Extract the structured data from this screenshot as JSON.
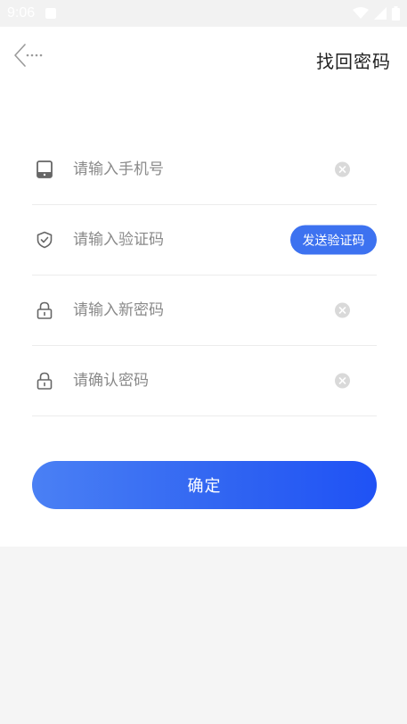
{
  "status_bar": {
    "time": "9:06"
  },
  "header": {
    "title": "找回密码",
    "back_icon": "back-arrow-icon"
  },
  "form": {
    "phone": {
      "placeholder": "请输入手机号",
      "value": "",
      "icon": "phone-icon"
    },
    "code": {
      "placeholder": "请输入验证码",
      "value": "",
      "icon": "shield-check-icon",
      "send_label": "发送验证码"
    },
    "new_password": {
      "placeholder": "请输入新密码",
      "value": "",
      "icon": "lock-icon"
    },
    "confirm_password": {
      "placeholder": "请确认密码",
      "value": "",
      "icon": "lock-icon"
    }
  },
  "actions": {
    "confirm_label": "确定"
  },
  "colors": {
    "accent": "#3d72f0",
    "gradient_start": "#4a80f4",
    "gradient_end": "#1f52f5",
    "page_bg": "#f5f5f5"
  }
}
